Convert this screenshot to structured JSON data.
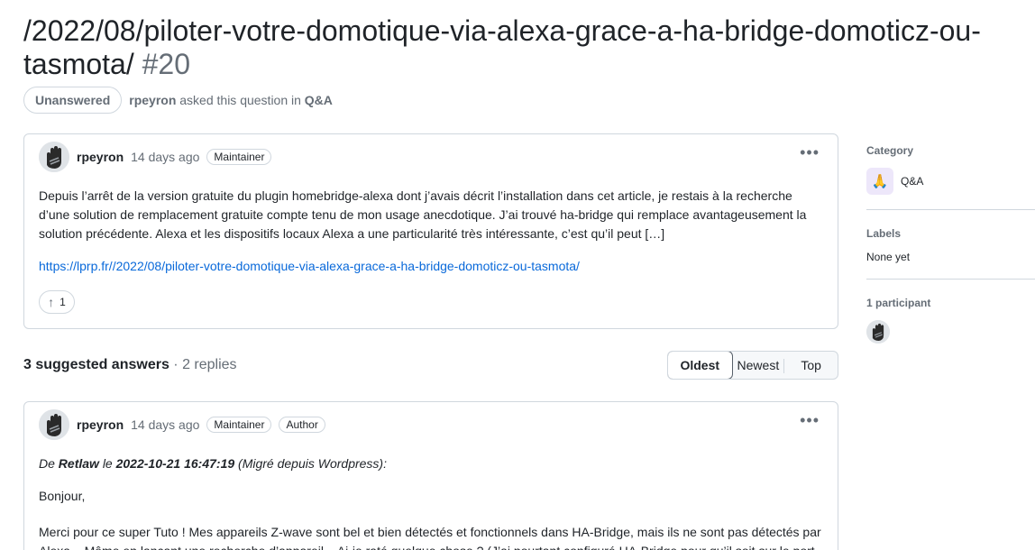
{
  "discussion": {
    "title": "/2022/08/piloter-votre-domotique-via-alexa-grace-a-ha-bridge-domoticz-ou-tasmota/",
    "number": "#20",
    "state": "Unanswered",
    "asker": "rpeyron",
    "asked_text": "asked this question in",
    "category_link": "Q&A"
  },
  "post": {
    "author": "rpeyron",
    "time": "14 days ago",
    "role": "Maintainer",
    "body": "Depuis l’arrêt de la version gratuite du plugin homebridge-alexa dont j’avais décrit l’installation dans cet article, je restais à la recherche d’une solution de remplacement gratuite compte tenu de mon usage anecdotique. J’ai trouvé ha-bridge qui remplace avantageusement la solution précédente. Alexa et les dispositifs locaux Alexa a une particularité très intéressante, c’est qu’il peut […]",
    "link": "https://lprp.fr//2022/08/piloter-votre-domotique-via-alexa-grace-a-ha-bridge-domoticz-ou-tasmota/",
    "upvotes": "1",
    "more_icon": "kebab-horizontal-icon"
  },
  "answers": {
    "count_label": "3 suggested answers",
    "separator": "·",
    "replies_label": "2 replies",
    "sort_options": [
      "Oldest",
      "Newest",
      "Top"
    ],
    "active_sort": "Oldest"
  },
  "answer1": {
    "author": "rpeyron",
    "time": "14 days ago",
    "roles": [
      "Maintainer",
      "Author"
    ],
    "intro_prefix": "De",
    "intro_name": "Retlaw",
    "intro_mid": "le",
    "intro_date": "2022-10-21 16:47:19",
    "intro_suffix": "(Migré depuis Wordpress):",
    "greeting": "Bonjour,",
    "body": "Merci pour ce super Tuto ! Mes appareils Z-wave sont bel et bien détectés et fonctionnels dans HA-Bridge, mais ils ne sont pas détectés par Alexa... Même en lançant une recherche d’appareil... Ai-je raté quelque chose ? (J’ai pourtant configuré HA-Bridge pour qu’il soit sur le port"
  },
  "sidebar": {
    "category_title": "Category",
    "category_name": "Q&A",
    "category_emoji": "🙏",
    "labels_title": "Labels",
    "labels_value": "None yet",
    "participants_title": "1 participant"
  },
  "colors": {
    "link": "#0969da",
    "muted": "#656d76",
    "border": "#d0d7de"
  }
}
